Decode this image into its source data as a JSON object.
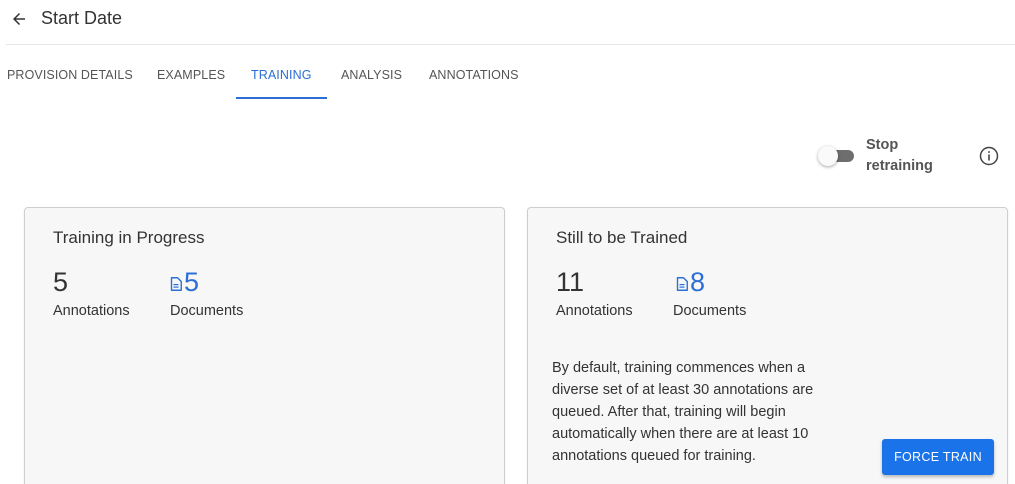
{
  "header": {
    "title": "Start Date",
    "back_icon": "arrow-left-icon"
  },
  "tabs": [
    {
      "label": "PROVISION DETAILS",
      "active": false
    },
    {
      "label": "EXAMPLES",
      "active": false
    },
    {
      "label": "TRAINING",
      "active": true
    },
    {
      "label": "ANALYSIS",
      "active": false
    },
    {
      "label": "ANNOTATIONS",
      "active": false
    }
  ],
  "retraining": {
    "label": "Stop retraining",
    "enabled": false,
    "info_icon": "info-circle-icon"
  },
  "cards": {
    "in_progress": {
      "title": "Training in Progress",
      "annotations": "5",
      "annotations_label": "Annotations",
      "documents": "5",
      "documents_label": "Documents",
      "document_icon": "document-icon"
    },
    "to_be_trained": {
      "title": "Still to be Trained",
      "annotations": "11",
      "annotations_label": "Annotations",
      "documents": "8",
      "documents_label": "Documents",
      "document_icon": "document-icon",
      "description": "By default, training commences when a diverse set of at least 30 annotations are queued. After that, training will begin automatically when there are at least 10 annotations queued for training.",
      "force_train_label": "FORCE TRAIN"
    }
  },
  "colors": {
    "accent": "#2b6fd6",
    "button": "#1a73e8",
    "card_background": "#f7f7f7",
    "toggle_track": "#6e6e6e"
  }
}
